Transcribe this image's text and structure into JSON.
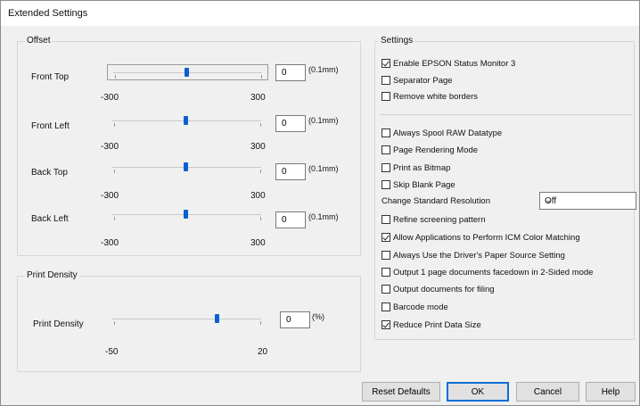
{
  "window": {
    "title": "Extended Settings"
  },
  "offset": {
    "legend": "Offset",
    "rows": [
      {
        "label": "Front Top",
        "value": "0",
        "unit": "(0.1mm)",
        "min_label": "-300",
        "max_label": "300",
        "level": 0
      },
      {
        "label": "Front Left",
        "value": "0",
        "unit": "(0.1mm)",
        "min_label": "-300",
        "max_label": "300",
        "level": 0
      },
      {
        "label": "Back Top",
        "value": "0",
        "unit": "(0.1mm)",
        "min_label": "-300",
        "max_label": "300",
        "level": 0
      },
      {
        "label": "Back Left",
        "value": "0",
        "unit": "(0.1mm)",
        "min_label": "-300",
        "max_label": "300",
        "level": 0
      }
    ]
  },
  "print_density": {
    "legend": "Print Density",
    "label": "Print Density",
    "value": "0",
    "unit": "(%)",
    "min_label": "-50",
    "max_label": "20",
    "level": 0
  },
  "settings": {
    "legend": "Settings",
    "group1": [
      {
        "label": "Enable EPSON Status Monitor 3",
        "checked": true
      },
      {
        "label": "Separator Page",
        "checked": false
      },
      {
        "label": "Remove white borders",
        "checked": false
      }
    ],
    "group2": [
      {
        "label": "Always Spool RAW Datatype",
        "checked": false
      },
      {
        "label": "Page Rendering Mode",
        "checked": false
      },
      {
        "label": "Print as Bitmap",
        "checked": false
      },
      {
        "label": "Skip Blank Page",
        "checked": false
      }
    ],
    "resolution_label": "Change Standard Resolution",
    "resolution_value": "Off",
    "group3": [
      {
        "label": "Refine screening pattern",
        "checked": false
      },
      {
        "label": "Allow Applications to Perform ICM Color Matching",
        "checked": true
      },
      {
        "label": "Always Use the Driver's Paper Source Setting",
        "checked": false
      },
      {
        "label": "Output 1 page documents facedown in 2-Sided mode",
        "checked": false
      },
      {
        "label": "Output documents for filing",
        "checked": false
      },
      {
        "label": "Barcode mode",
        "checked": false
      },
      {
        "label": "Reduce Print Data Size",
        "checked": true
      }
    ]
  },
  "buttons": {
    "reset": "Reset Defaults",
    "ok": "OK",
    "cancel": "Cancel",
    "help": "Help"
  },
  "colors": {
    "accent": "#0a5fd1",
    "dialog_bg": "#f0f0f0"
  }
}
